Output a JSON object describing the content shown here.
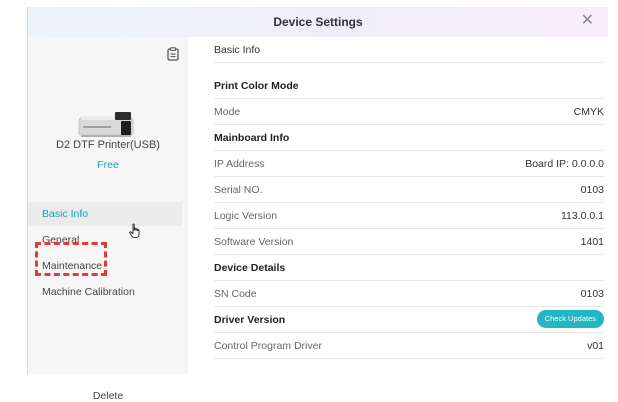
{
  "window": {
    "title": "Device Settings",
    "close_glyph": "✕"
  },
  "sidebar": {
    "device_name": "D2 DTF Printer(USB)",
    "status": "Free",
    "nav": [
      {
        "label": "Basic Info",
        "active": true
      },
      {
        "label": "General",
        "active": false
      },
      {
        "label": "Maintenance",
        "active": false
      },
      {
        "label": "Machine Calibration",
        "active": false
      }
    ],
    "delete_label": "Delete"
  },
  "main": {
    "rows": [
      {
        "label": "Basic Info",
        "type": "header"
      },
      {
        "label": "Print Color Mode",
        "type": "section"
      },
      {
        "label": "Mode",
        "value": "CMYK"
      },
      {
        "label": "Mainboard Info",
        "type": "section"
      },
      {
        "label": "IP Address",
        "value": "Board IP: 0.0.0.0"
      },
      {
        "label": "Serial NO.",
        "value": "0103"
      },
      {
        "label": "Logic Version",
        "value": "113.0.0.1"
      },
      {
        "label": "Software Version",
        "value": "1401"
      },
      {
        "label": "Device Details",
        "type": "section"
      },
      {
        "label": "SN Code",
        "value": "0103"
      },
      {
        "label": "Driver Version",
        "type": "section",
        "button": "Check Updates"
      },
      {
        "label": "Control Program Driver",
        "value": "v01"
      }
    ]
  },
  "colors": {
    "accent": "#1aa0b4",
    "button": "#22b6c4",
    "highlight": "#e53935"
  }
}
